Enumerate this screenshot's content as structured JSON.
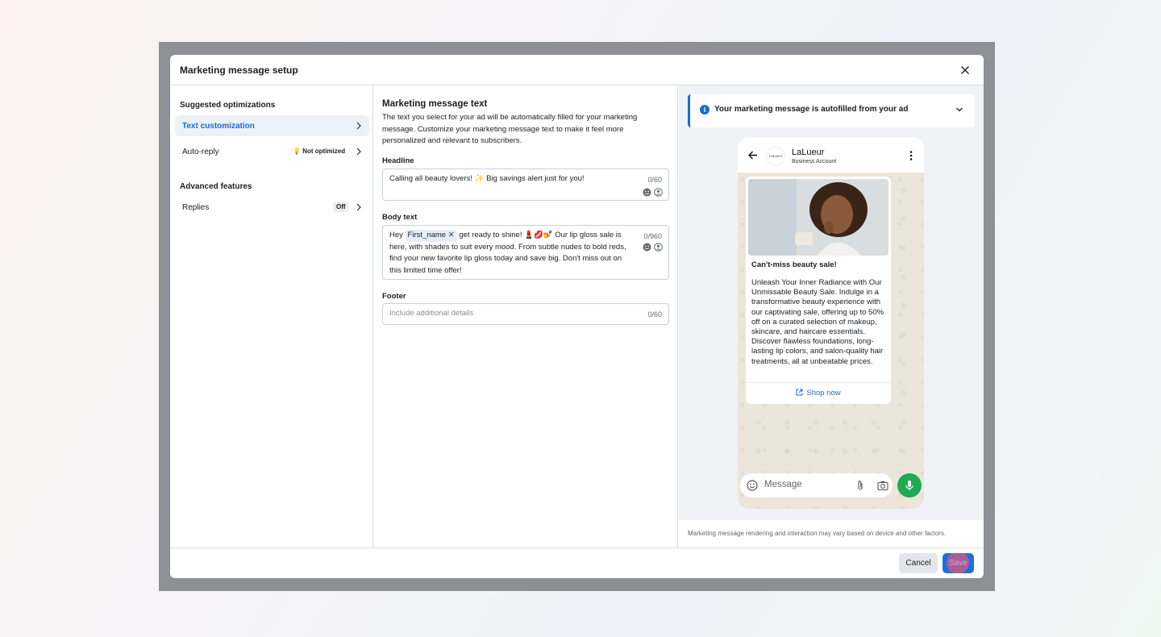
{
  "dialog": {
    "title": "Marketing message setup"
  },
  "left": {
    "suggested_heading": "Suggested optimizations",
    "items": [
      {
        "label": "Text customization",
        "active": true
      },
      {
        "label": "Auto-reply",
        "badge": "Not optimized"
      }
    ],
    "advanced_heading": "Advanced features",
    "advanced_items": [
      {
        "label": "Replies",
        "badge": "Off"
      }
    ]
  },
  "middle": {
    "title": "Marketing message text",
    "description": "The text you select for your ad will be automatically filled for your marketing message. Customize your marketing message text to make it feel more personalized and relevant to subscribers.",
    "headline": {
      "label": "Headline",
      "value": "Calling all beauty lovers! ✨ Big savings alert just for you!",
      "counter": "0/60"
    },
    "body": {
      "label": "Body text",
      "prefix": "Hey",
      "token": "First_name",
      "value": "get ready to shine! 💄💋💅 Our lip gloss sale is here, with shades to suit every mood. From subtle nudes to bold reds, find your new favorite lip gloss today and save big. Don't miss out on this limited time offer!",
      "counter": "0/960"
    },
    "footer": {
      "label": "Footer",
      "placeholder": "Include additional details",
      "counter": "0/60"
    }
  },
  "preview": {
    "banner": "Your marketing message is autofilled from your ad",
    "brand_name": "LaLueur",
    "brand_sub": "Business Account",
    "avatar_text": "LaLueur",
    "msg_headline": "Can't-miss beauty sale!",
    "msg_body": "Unleash Your Inner Radiance with Our Unmissable Beauty Sale. Indulge in a transformative beauty experience with our captivating sale, offering up to 50% off on a curated selection of makeup, skincare, and haircare essentials. Discover flawless foundations, long-lasting lip colors, and salon-quality hair treatments, all at unbeatable prices.",
    "cta": "Shop now",
    "input_placeholder": "Message",
    "disclaimer": "Marketing message rendering and interaction may vary based on device and other factors."
  },
  "footer": {
    "cancel": "Cancel",
    "save": "Save"
  },
  "colors": {
    "accent": "#1a6ad1",
    "whatsapp_green": "#1faa53",
    "save_button": "#1d70e0"
  }
}
